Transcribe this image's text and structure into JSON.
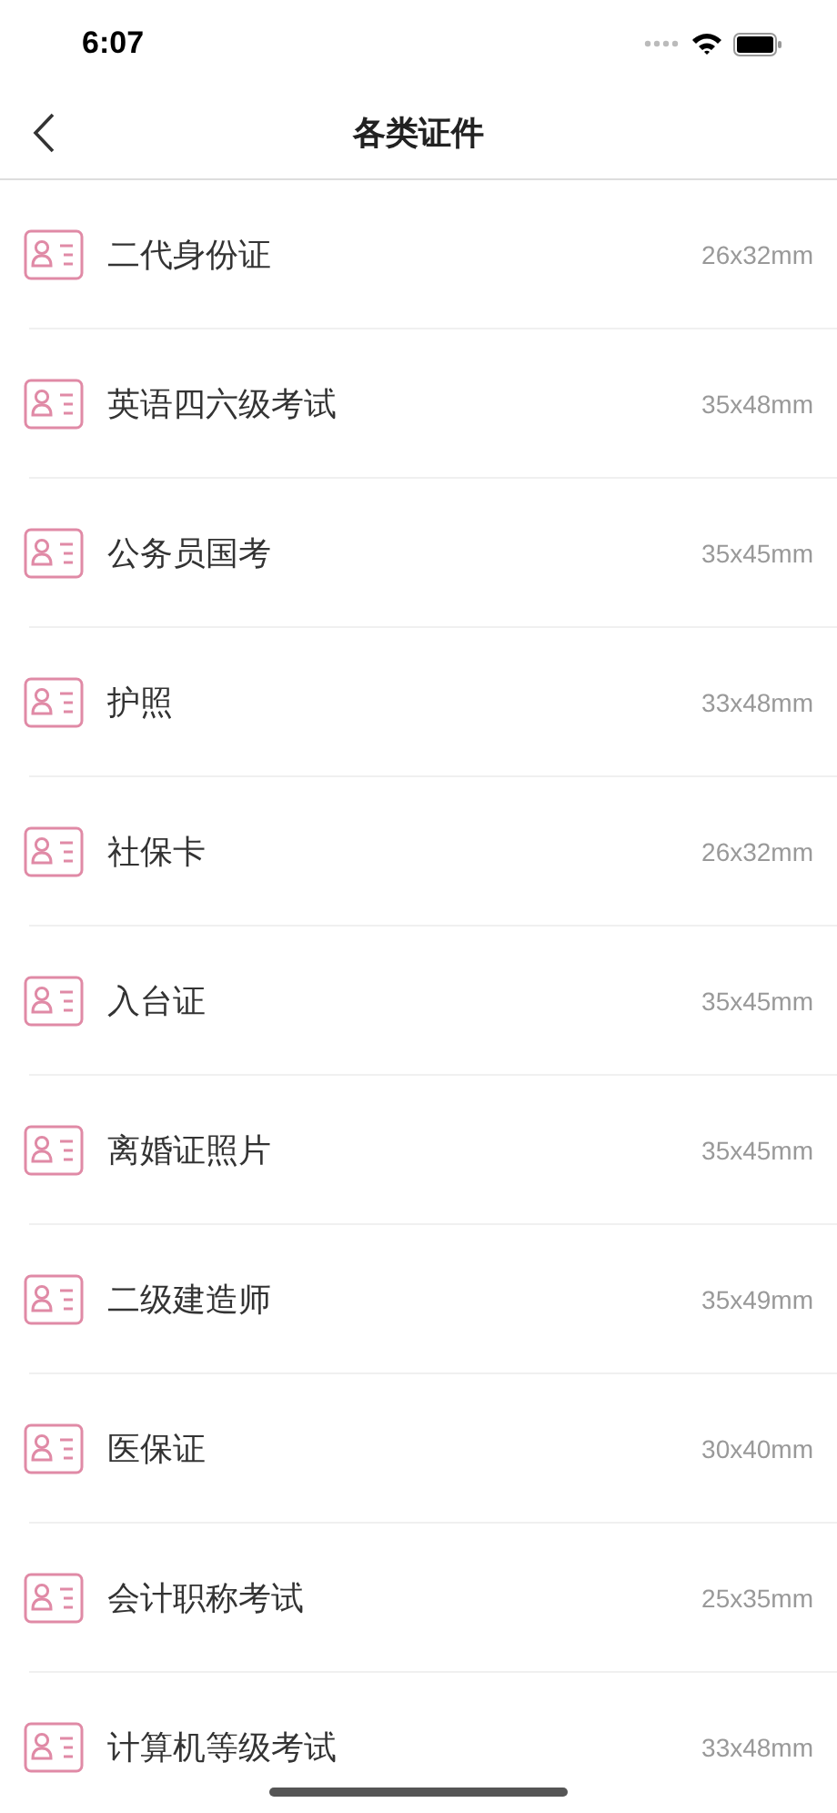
{
  "status_bar": {
    "time": "6:07"
  },
  "nav": {
    "title": "各类证件"
  },
  "items": [
    {
      "name": "二代身份证",
      "size": "26x32mm"
    },
    {
      "name": "英语四六级考试",
      "size": "35x48mm"
    },
    {
      "name": "公务员国考",
      "size": "35x45mm"
    },
    {
      "name": "护照",
      "size": "33x48mm"
    },
    {
      "name": "社保卡",
      "size": "26x32mm"
    },
    {
      "name": "入台证",
      "size": "35x45mm"
    },
    {
      "name": "离婚证照片",
      "size": "35x45mm"
    },
    {
      "name": "二级建造师",
      "size": "35x49mm"
    },
    {
      "name": "医保证",
      "size": "30x40mm"
    },
    {
      "name": "会计职称考试",
      "size": "25x35mm"
    },
    {
      "name": "计算机等级考试",
      "size": "33x48mm"
    }
  ]
}
